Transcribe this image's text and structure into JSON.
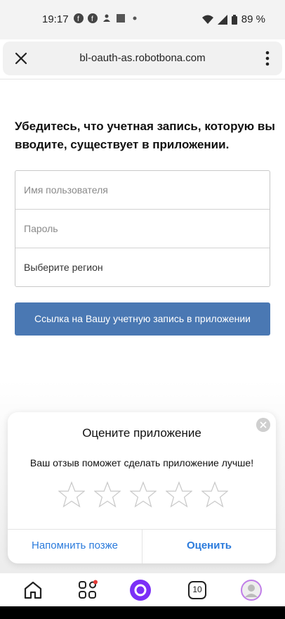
{
  "status_bar": {
    "time": "19:17",
    "battery": "89 %",
    "icons": [
      "facebook-icon",
      "facebook-icon",
      "notification-icon",
      "square-icon",
      "dot-icon",
      "wifi-icon",
      "signal-icon",
      "battery-icon"
    ]
  },
  "url_bar": {
    "url": "bl-oauth-as.robotbona.com",
    "close_icon": "close-icon",
    "menu_icon": "more-vert-icon"
  },
  "main": {
    "heading": "Убедитесь, что учетная запись, которую вы вводите, существует в приложении.",
    "username_placeholder": "Имя пользователя",
    "password_placeholder": "Пароль",
    "region_value": "Выберите регион",
    "link_button": "Ссылка на Вашу учетную запись в приложении"
  },
  "rating_dialog": {
    "title": "Оцените приложение",
    "subtitle": "Ваш отзыв поможет сделать приложение лучше!",
    "stars_selected": 0,
    "stars_total": 5,
    "remind_later": "Напомнить позже",
    "rate": "Оценить"
  },
  "bottom_nav": {
    "items": [
      "home-icon",
      "services-icon",
      "alice-icon",
      "tabs-icon",
      "profile-icon"
    ],
    "tabs_count": "10",
    "accent_color": "#7b2ff7"
  }
}
